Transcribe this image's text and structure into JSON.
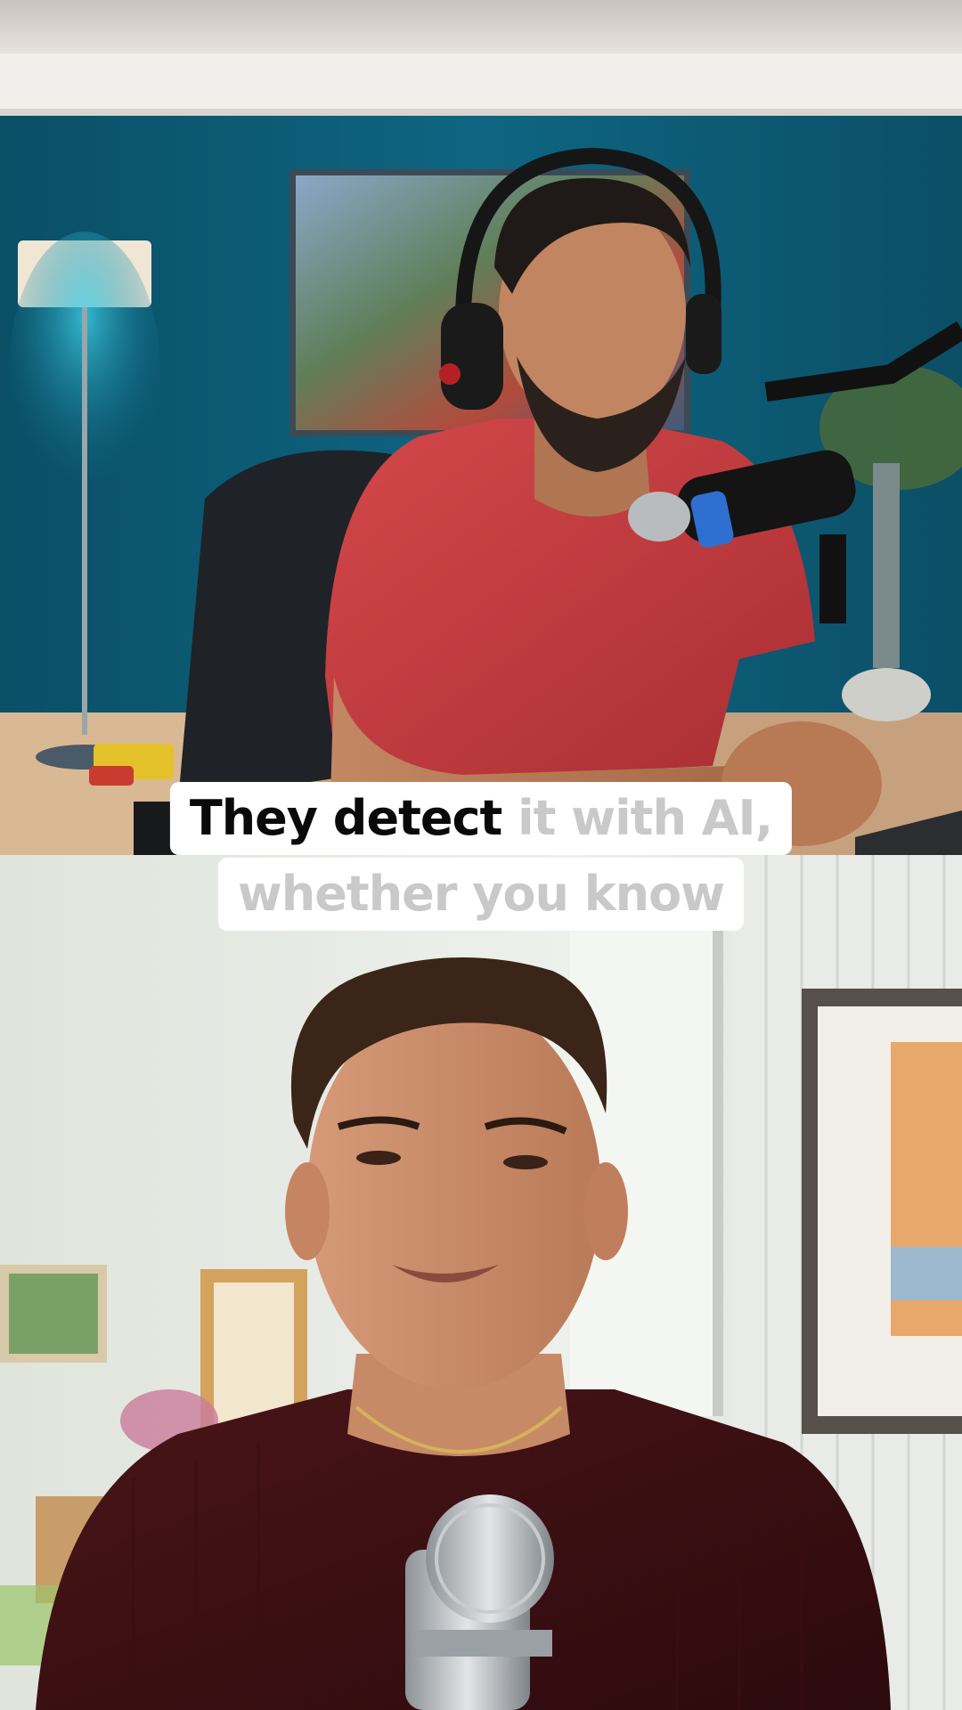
{
  "caption": {
    "line1_spoken": "They detect",
    "line1_upcoming": "it with AI,",
    "line2_upcoming": "whether you know"
  },
  "colors": {
    "caption_background": "#ffffff",
    "spoken_text": "#0a0a0a",
    "upcoming_text": "#c9c9c9",
    "top_wall": "#0d5a72",
    "bottom_wall": "#e8eae6"
  },
  "scene": {
    "top": "person-with-headphones-at-podcast-microphone",
    "bottom": "person-speaking-into-silver-microphone"
  }
}
